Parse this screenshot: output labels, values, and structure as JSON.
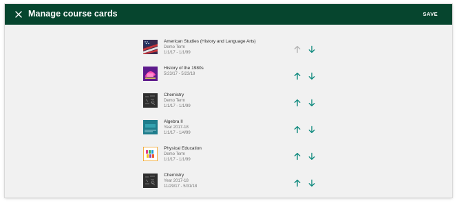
{
  "header": {
    "title": "Manage course cards",
    "save_label": "SAVE",
    "close_icon": "close-icon",
    "background": "#06452e"
  },
  "courses": [
    {
      "name": "American Studies (History and Language Arts)",
      "term": "Demo Term",
      "dates": "1/1/17 - 1/1/99",
      "thumbnail": "american-flag-image",
      "up_enabled": false
    },
    {
      "name": "History of the 1980s",
      "term": "",
      "dates": "5/23/17 - 5/23/18",
      "thumbnail": "eighties-graphic-image",
      "up_enabled": true
    },
    {
      "name": "Chemistry",
      "term": "Demo Term",
      "dates": "1/1/17 - 1/1/99",
      "thumbnail": "chalkboard-image",
      "up_enabled": true
    },
    {
      "name": "Algebra II",
      "term": "Year 2017-18",
      "dates": "1/1/17 - 1/4/99",
      "thumbnail": "algebra-teal-image",
      "up_enabled": true
    },
    {
      "name": "Physical Education",
      "term": "Demo Term",
      "dates": "1/1/17 - 1/1/99",
      "thumbnail": "colorful-letters-image",
      "up_enabled": true
    },
    {
      "name": "Chemistry",
      "term": "Year 2017-18",
      "dates": "11/29/17 - 5/31/18",
      "thumbnail": "chalkboard-image",
      "up_enabled": true
    }
  ],
  "colors": {
    "arrow_active": "#0f8a7e",
    "arrow_disabled": "#b5b5b5"
  }
}
